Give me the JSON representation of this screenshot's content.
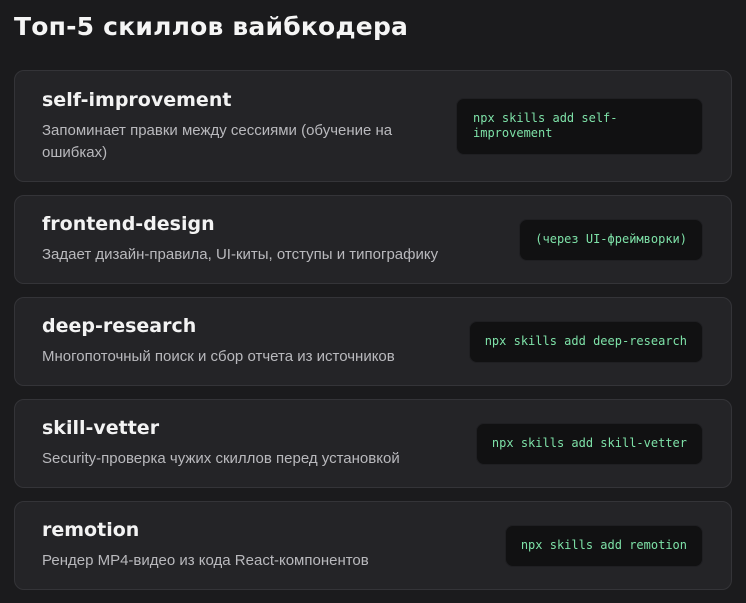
{
  "page": {
    "title": "Топ-5 скиллов вайбкодера"
  },
  "skills": [
    {
      "name": "self-improvement",
      "description": "Запоминает правки между сессиями (обучение на ошибках)",
      "command": "npx skills add self-improvement"
    },
    {
      "name": "frontend-design",
      "description": "Задает дизайн-правила, UI-киты, отступы и типографику",
      "command": "(через UI-фреймворки)"
    },
    {
      "name": "deep-research",
      "description": "Многопоточный поиск и сбор отчета из источников",
      "command": "npx skills add deep-research"
    },
    {
      "name": "skill-vetter",
      "description": "Security-проверка чужих скиллов перед установкой",
      "command": "npx skills add skill-vetter"
    },
    {
      "name": "remotion",
      "description": "Рендер MP4-видео из кода React-компонентов",
      "command": "npx skills add remotion"
    }
  ]
}
